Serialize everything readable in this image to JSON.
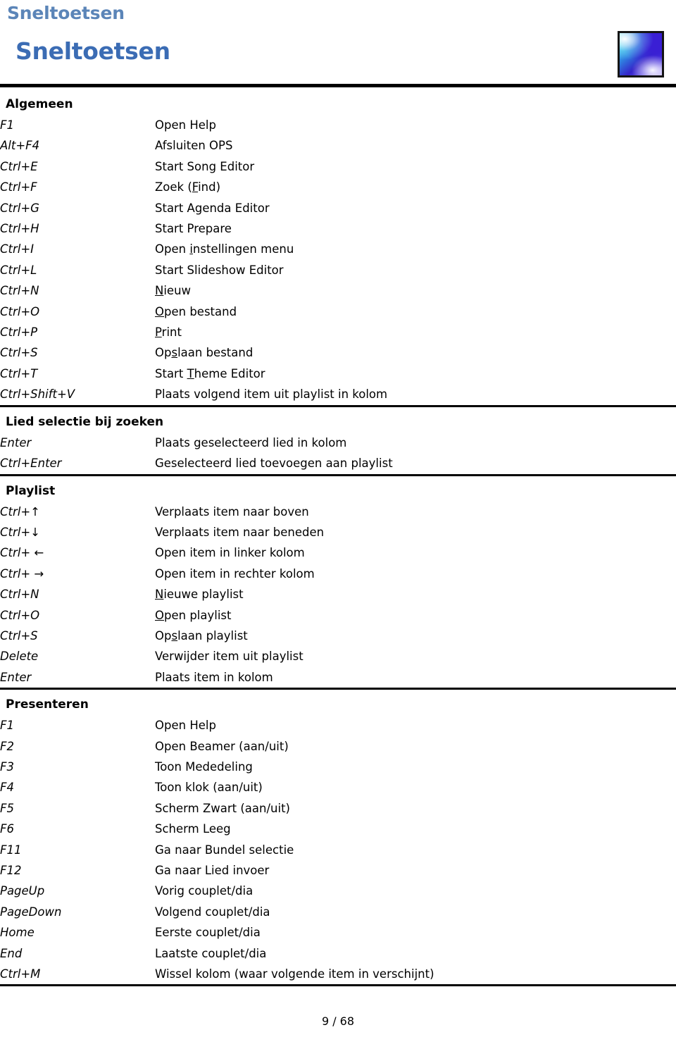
{
  "header": {
    "running_title": "Sneltoetsen",
    "main_title": "Sneltoetsen",
    "logo_name": "app-logo-gradient-swirl",
    "title_color": "#3b6cb4",
    "running_title_color": "#5b85b8",
    "rule_color": "#000000"
  },
  "footer": {
    "page_indicator": "9 / 68"
  },
  "sections": [
    {
      "id": "algemeen",
      "title": "Algemeen",
      "rows": [
        {
          "key": "F1",
          "desc": "Open Help"
        },
        {
          "key": "Alt+F4",
          "desc": "Afsluiten OPS"
        },
        {
          "key": "Ctrl+E",
          "desc": "Start Song Editor"
        },
        {
          "key": "Ctrl+F",
          "desc": "Zoek (Find)",
          "underline": "F"
        },
        {
          "key": "Ctrl+G",
          "desc": "Start Agenda Editor",
          "underline": "g"
        },
        {
          "key": "Ctrl+H",
          "desc": "Start Prepare"
        },
        {
          "key": "Ctrl+I",
          "desc": "Open instellingen menu",
          "underline": "i"
        },
        {
          "key": "Ctrl+L",
          "desc": "Start Slideshow Editor"
        },
        {
          "key": "Ctrl+N",
          "desc": "Nieuw",
          "underline": "N"
        },
        {
          "key": "Ctrl+O",
          "desc": "Open bestand",
          "underline": "O"
        },
        {
          "key": "Ctrl+P",
          "desc": "Print",
          "underline": "P"
        },
        {
          "key": "Ctrl+S",
          "desc": "Opslaan bestand",
          "underline": "s"
        },
        {
          "key": "Ctrl+T",
          "desc": "Start Theme Editor",
          "underline": "T"
        },
        {
          "key": "Ctrl+Shift+V",
          "desc": "Plaats volgend item uit playlist in kolom"
        }
      ]
    },
    {
      "id": "lied-selectie-bij-zoeken",
      "title": "Lied selectie bij zoeken",
      "rows": [
        {
          "key": "Enter",
          "desc": "Plaats geselecteerd lied in kolom"
        },
        {
          "key": "Ctrl+Enter",
          "desc": "Geselecteerd lied toevoegen aan playlist"
        }
      ]
    },
    {
      "id": "playlist",
      "title": "Playlist",
      "rows": [
        {
          "key": "Ctrl+↑",
          "desc": "Verplaats item naar boven"
        },
        {
          "key": "Ctrl+↓",
          "desc": "Verplaats item naar beneden"
        },
        {
          "key": "Ctrl+ ←",
          "desc": "Open item in linker kolom"
        },
        {
          "key": "Ctrl+ →",
          "desc": "Open item in rechter kolom"
        },
        {
          "key": "Ctrl+N",
          "desc": "Nieuwe playlist",
          "underline": "N"
        },
        {
          "key": "Ctrl+O",
          "desc": "Open playlist",
          "underline": "O"
        },
        {
          "key": "Ctrl+S",
          "desc": "Opslaan playlist",
          "underline": "s"
        },
        {
          "key": "Delete",
          "desc": "Verwijder item uit playlist"
        },
        {
          "key": "Enter",
          "desc": "Plaats item in kolom"
        }
      ]
    },
    {
      "id": "presenteren",
      "title": "Presenteren",
      "rows": [
        {
          "key": "F1",
          "desc": "Open Help"
        },
        {
          "key": "F2",
          "desc": "Open Beamer (aan/uit)"
        },
        {
          "key": "F3",
          "desc": "Toon Mededeling"
        },
        {
          "key": "F4",
          "desc": "Toon klok (aan/uit)"
        },
        {
          "key": "F5",
          "desc": "Scherm Zwart (aan/uit)"
        },
        {
          "key": "F6",
          "desc": "Scherm Leeg"
        },
        {
          "key": "F11",
          "desc": "Ga naar Bundel selectie"
        },
        {
          "key": "F12",
          "desc": "Ga naar Lied invoer"
        },
        {
          "key": "PageUp",
          "desc": "Vorig couplet/dia"
        },
        {
          "key": "PageDown",
          "desc": "Volgend couplet/dia"
        },
        {
          "key": "Home",
          "desc": "Eerste couplet/dia"
        },
        {
          "key": "End",
          "desc": "Laatste couplet/dia"
        },
        {
          "key": "Ctrl+M",
          "desc": "Wissel kolom (waar volgende item in verschijnt)"
        }
      ]
    }
  ]
}
